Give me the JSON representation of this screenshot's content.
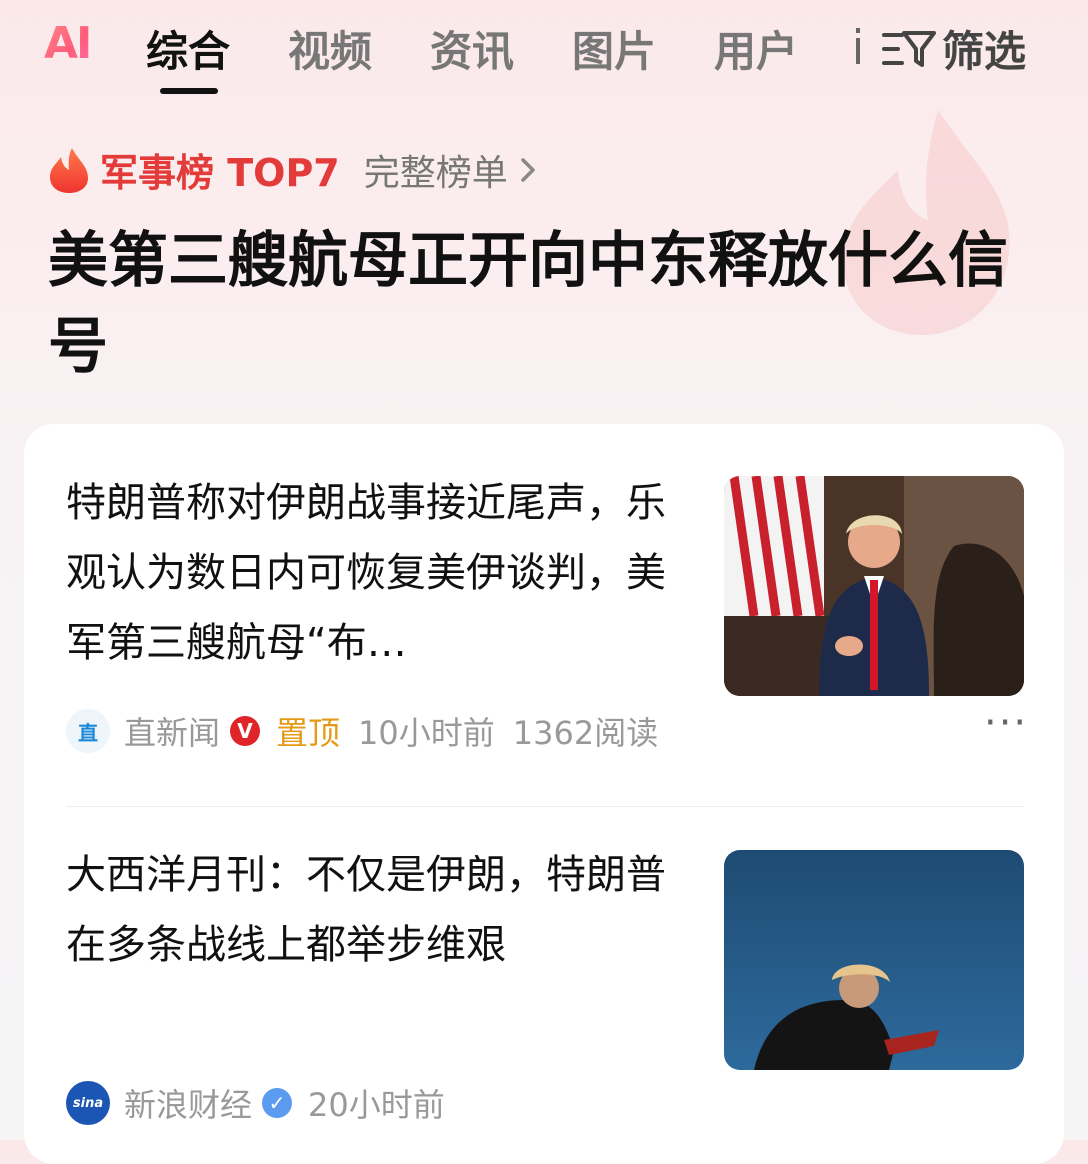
{
  "nav": {
    "logo": "AI",
    "tabs": [
      {
        "label": "综合",
        "active": true
      },
      {
        "label": "视频"
      },
      {
        "label": "资讯"
      },
      {
        "label": "图片"
      },
      {
        "label": "用户"
      }
    ],
    "filter_label": "筛选",
    "filter_icon": "funnel-icon"
  },
  "hot": {
    "icon": "flame-icon",
    "title": "军事榜 TOP7",
    "link": "完整榜单",
    "accent": "#e33a3a"
  },
  "headline": "美第三艘航母正开向中东释放什么信号",
  "news": [
    {
      "title": "特朗普称对伊朗战事接近尾声，乐观认为数日内可恢复美伊谈判，美军第三艘航母“布…",
      "source": "直新闻",
      "source_icon_text": "直",
      "verified_badge": "V",
      "pinned": "置顶",
      "time": "10小时前",
      "reads": "1362阅读"
    },
    {
      "title": "大西洋月刊：不仅是伊朗，特朗普在多条战线上都举步维艰",
      "source": "新浪财经",
      "source_icon_text": "sina",
      "verified_badge": "✓",
      "time": "20小时前"
    }
  ]
}
